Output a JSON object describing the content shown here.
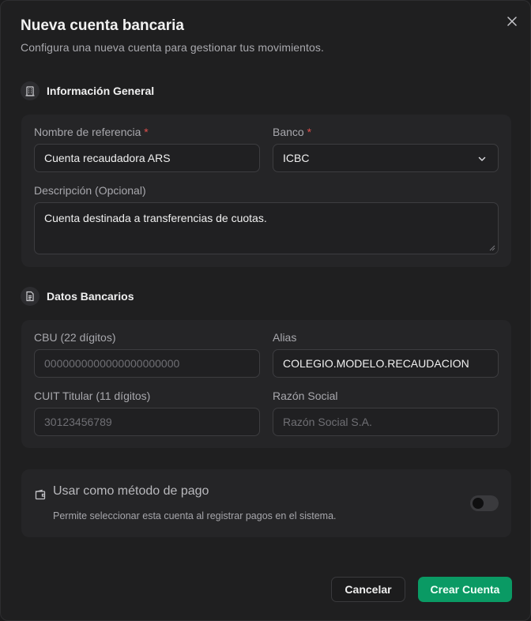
{
  "dialog": {
    "title": "Nueva cuenta bancaria",
    "subtitle": "Configura una nueva cuenta para gestionar tus movimientos."
  },
  "general": {
    "section_title": "Información General",
    "section_icon": "building-icon",
    "name_label": "Nombre de referencia",
    "name_value": "Cuenta recaudadora ARS",
    "bank_label": "Banco",
    "bank_value": "ICBC",
    "required_mark": "*",
    "description_label": "Descripción (Opcional)",
    "description_value": "Cuenta destinada a transferencias de cuotas."
  },
  "banking": {
    "section_title": "Datos Bancarios",
    "section_icon": "document-icon",
    "cbu_label": "CBU (22 dígitos)",
    "cbu_placeholder": "0000000000000000000000",
    "alias_label": "Alias",
    "alias_value": "COLEGIO.MODELO.RECAUDACION",
    "cuit_label": "CUIT Titular (11 dígitos)",
    "cuit_placeholder": "30123456789",
    "business_label": "Razón Social",
    "business_placeholder": "Razón Social S.A."
  },
  "payment_method": {
    "icon": "wallet-icon",
    "title": "Usar como método de pago",
    "description": "Permite seleccionar esta cuenta al registrar pagos en el sistema.",
    "enabled": false
  },
  "actions": {
    "cancel_label": "Cancelar",
    "create_label": "Crear Cuenta"
  },
  "colors": {
    "primary": "#0a9a64",
    "required": "#e0504d",
    "background": "#1f1f20"
  }
}
